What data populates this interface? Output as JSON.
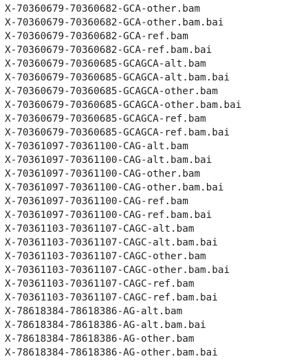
{
  "files": [
    "X-70360679-70360682-GCA-other.bam",
    "X-70360679-70360682-GCA-other.bam.bai",
    "X-70360679-70360682-GCA-ref.bam",
    "X-70360679-70360682-GCA-ref.bam.bai",
    "X-70360679-70360685-GCAGCA-alt.bam",
    "X-70360679-70360685-GCAGCA-alt.bam.bai",
    "X-70360679-70360685-GCAGCA-other.bam",
    "X-70360679-70360685-GCAGCA-other.bam.bai",
    "X-70360679-70360685-GCAGCA-ref.bam",
    "X-70360679-70360685-GCAGCA-ref.bam.bai",
    "X-70361097-70361100-CAG-alt.bam",
    "X-70361097-70361100-CAG-alt.bam.bai",
    "X-70361097-70361100-CAG-other.bam",
    "X-70361097-70361100-CAG-other.bam.bai",
    "X-70361097-70361100-CAG-ref.bam",
    "X-70361097-70361100-CAG-ref.bam.bai",
    "X-70361103-70361107-CAGC-alt.bam",
    "X-70361103-70361107-CAGC-alt.bam.bai",
    "X-70361103-70361107-CAGC-other.bam",
    "X-70361103-70361107-CAGC-other.bam.bai",
    "X-70361103-70361107-CAGC-ref.bam",
    "X-70361103-70361107-CAGC-ref.bam.bai",
    "X-78618384-78618386-AG-alt.bam",
    "X-78618384-78618386-AG-alt.bam.bai",
    "X-78618384-78618386-AG-other.bam",
    "X-78618384-78618386-AG-other.bam.bai"
  ]
}
